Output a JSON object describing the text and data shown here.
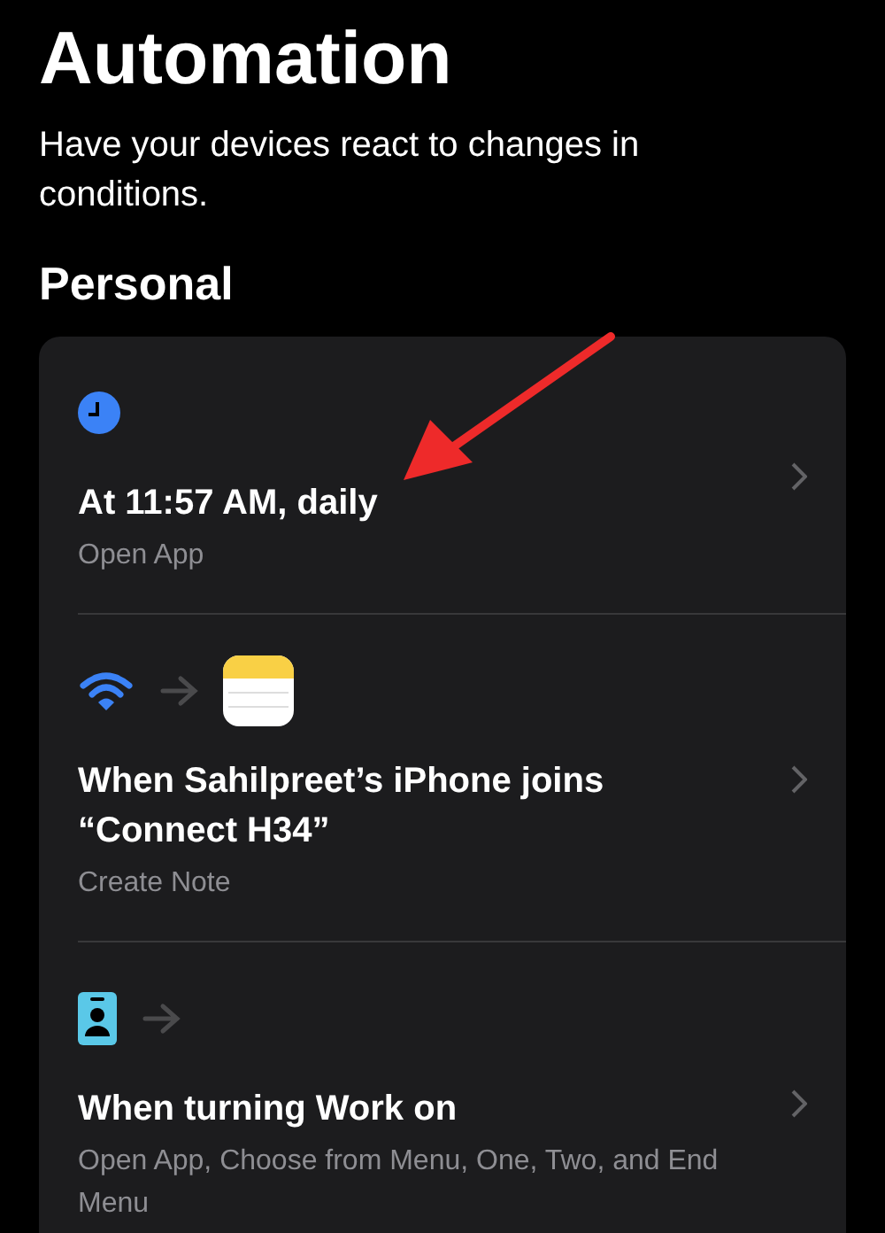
{
  "title": "Automation",
  "subtitle": "Have your devices react to changes in conditions.",
  "section": "Personal",
  "automations": [
    {
      "icons": [
        {
          "kind": "clock"
        }
      ],
      "title": "At 11:57 AM, daily",
      "detail": "Open App"
    },
    {
      "icons": [
        {
          "kind": "wifi"
        },
        {
          "kind": "arrow"
        },
        {
          "kind": "notes"
        }
      ],
      "title": "When Sahilpreet’s iPhone joins “Connect H34”",
      "detail": "Create Note"
    },
    {
      "icons": [
        {
          "kind": "badge"
        },
        {
          "kind": "arrow"
        }
      ],
      "title": "When turning Work on",
      "detail": "Open App, Choose from Menu, One, Two, and End Menu"
    }
  ]
}
